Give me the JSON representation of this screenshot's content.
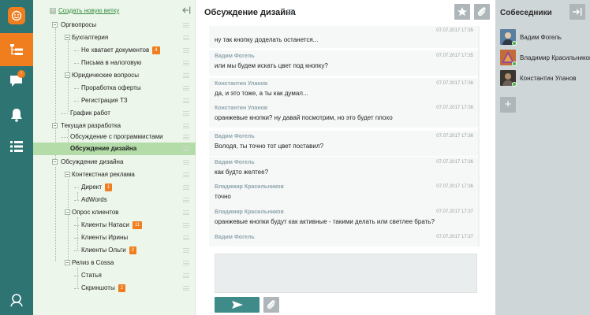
{
  "colors": {
    "accent": "#f07d1e",
    "rail": "#2e7473",
    "tree_bg": "#edf6ea",
    "selected": "#b3dca8",
    "people_bg": "#cfd6d8",
    "send": "#3e8b8a"
  },
  "rail": {
    "icons": [
      "smiley-logo-icon",
      "branches-icon",
      "chat-icon",
      "bell-icon",
      "list-icon",
      "user-icon"
    ],
    "chat_badge": "!"
  },
  "tree": {
    "new_branch_label": "Создать новую ветку",
    "items": [
      {
        "label": "Оргвопросы"
      },
      {
        "label": "Бухгалтерия"
      },
      {
        "label": "Не хватает документов",
        "badge": "4"
      },
      {
        "label": "Письма в налоговую"
      },
      {
        "label": "Юридические вопросы"
      },
      {
        "label": "Проработка оферты"
      },
      {
        "label": "Регистрация ТЗ"
      },
      {
        "label": "График работ"
      },
      {
        "label": "Текущая разработка"
      },
      {
        "label": "Обсуждение с программистами"
      },
      {
        "label": "Обсуждение дизайна"
      },
      {
        "label": "Обсуждение дизайна"
      },
      {
        "label": "Контекстная реклама"
      },
      {
        "label": "Директ",
        "badge": "1"
      },
      {
        "label": "AdWords"
      },
      {
        "label": "Опрос клиентов"
      },
      {
        "label": "Клиенты Натаси",
        "badge": "11"
      },
      {
        "label": "Клиенты Ирины"
      },
      {
        "label": "Клиенты Ольги",
        "badge": "2"
      },
      {
        "label": "Релиз в Cossa"
      },
      {
        "label": "Статья"
      },
      {
        "label": "Скриншоты",
        "badge": "2"
      }
    ]
  },
  "chat": {
    "title": "Обсуждение дизайна",
    "messages": [
      {
        "author": "",
        "time": "07.07.2017 17:35",
        "text": "ну так кнопку доделать останется..."
      },
      {
        "author": "Вадим Фогель",
        "time": "07.07.2017 17:35",
        "text": "или мы будем искать цвет под кнопку?"
      },
      {
        "author": "Константин Уланов",
        "time": "07.07.2017 17:36",
        "text": "да, и это тоже, а ты как думал..."
      },
      {
        "author": "Константин Уланов",
        "time": "07.07.2017 17:36",
        "text": "оранжевые кнопки? ну давай посмотрим, но это будет плохо"
      },
      {
        "author": "Вадим Фогель",
        "time": "07.07.2017 17:36",
        "text": "Володя, ты точно тот цвет поставил?"
      },
      {
        "author": "Вадим Фогель",
        "time": "07.07.2017 17:36",
        "text": "как будто желтее?"
      },
      {
        "author": "Владимир Красильников",
        "time": "07.07.2017 17:36",
        "text": "точно"
      },
      {
        "author": "Владимир Красильников",
        "time": "07.07.2017 17:37",
        "text": "оранжевые кнопки будут как активные - такими делать или светлее брать?"
      },
      {
        "author": "Вадим Фогель",
        "time": "07.07.2017 17:37",
        "text": ""
      }
    ]
  },
  "people": {
    "title": "Собеседники",
    "list": [
      {
        "name": "Вадим Фогель",
        "avatar_color": "#5a7ea0"
      },
      {
        "name": "Владимир Красильников",
        "avatar_color": "#c46b3a"
      },
      {
        "name": "Константин Уланов",
        "avatar_color": "#3b3530"
      }
    ]
  }
}
